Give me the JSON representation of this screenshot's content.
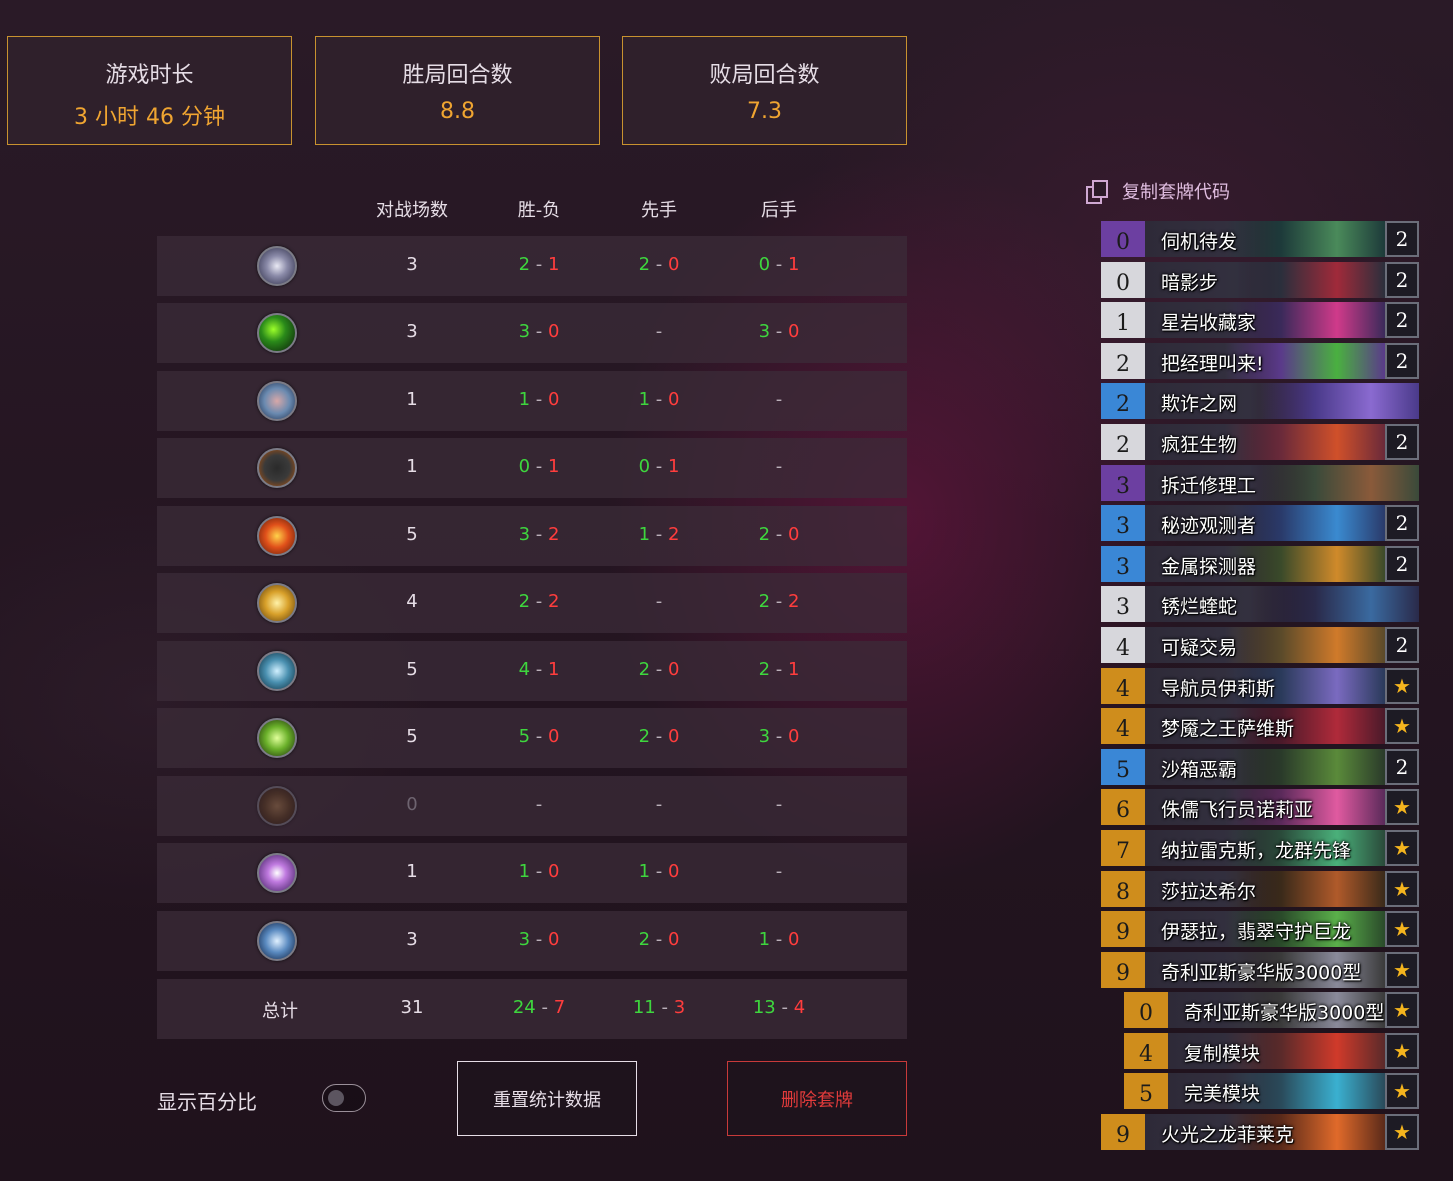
{
  "summary": [
    {
      "label": "游戏时长",
      "value": "3 小时 46 分钟"
    },
    {
      "label": "胜局回合数",
      "value": "8.8"
    },
    {
      "label": "败局回合数",
      "value": "7.3"
    }
  ],
  "table": {
    "headers": [
      "对战场数",
      "胜-负",
      "先手",
      "后手"
    ],
    "rows": [
      {
        "icon": "priest-class-icon",
        "games": "3",
        "wl": [
          "2",
          "1"
        ],
        "first": [
          "2",
          "0"
        ],
        "second": [
          "0",
          "1"
        ]
      },
      {
        "icon": "druid-class-icon",
        "games": "3",
        "wl": [
          "3",
          "0"
        ],
        "first": null,
        "second": [
          "3",
          "0"
        ]
      },
      {
        "icon": "shaman-class-icon",
        "games": "1",
        "wl": [
          "1",
          "0"
        ],
        "first": [
          "1",
          "0"
        ],
        "second": null
      },
      {
        "icon": "hunter-class-icon",
        "games": "1",
        "wl": [
          "0",
          "1"
        ],
        "first": [
          "0",
          "1"
        ],
        "second": null
      },
      {
        "icon": "mage-class-icon",
        "games": "5",
        "wl": [
          "3",
          "2"
        ],
        "first": [
          "1",
          "2"
        ],
        "second": [
          "2",
          "0"
        ]
      },
      {
        "icon": "paladin-class-icon",
        "games": "4",
        "wl": [
          "2",
          "2"
        ],
        "first": null,
        "second": [
          "2",
          "2"
        ]
      },
      {
        "icon": "deathknight-class-icon",
        "games": "5",
        "wl": [
          "4",
          "1"
        ],
        "first": [
          "2",
          "0"
        ],
        "second": [
          "2",
          "1"
        ]
      },
      {
        "icon": "demonhunter-class-icon",
        "games": "5",
        "wl": [
          "5",
          "0"
        ],
        "first": [
          "2",
          "0"
        ],
        "second": [
          "3",
          "0"
        ]
      },
      {
        "icon": "warrior-class-icon",
        "games": "0",
        "wl": null,
        "first": null,
        "second": null,
        "dim": true
      },
      {
        "icon": "warlock-class-icon",
        "games": "1",
        "wl": [
          "1",
          "0"
        ],
        "first": [
          "1",
          "0"
        ],
        "second": null
      },
      {
        "icon": "rogue-class-icon",
        "games": "3",
        "wl": [
          "3",
          "0"
        ],
        "first": [
          "2",
          "0"
        ],
        "second": [
          "1",
          "0"
        ]
      }
    ],
    "total": {
      "label": "总计",
      "games": "31",
      "wl": [
        "24",
        "7"
      ],
      "first": [
        "11",
        "3"
      ],
      "second": [
        "13",
        "4"
      ]
    },
    "dash": "-"
  },
  "controls": {
    "show_percent_label": "显示百分比",
    "show_percent_on": false,
    "reset_label": "重置统计数据",
    "delete_label": "删除套牌"
  },
  "deck": {
    "copy_label": "复制套牌代码",
    "cards": [
      {
        "cost": "0",
        "name": "伺机待发",
        "count": "2",
        "rarity": "purple",
        "art": [
          "#1d3a3a",
          "#4a8a5a"
        ]
      },
      {
        "cost": "0",
        "name": "暗影步",
        "count": "2",
        "rarity": "white",
        "art": [
          "#2b2f3c",
          "#a02a3a"
        ]
      },
      {
        "cost": "1",
        "name": "星岩收藏家",
        "count": "2",
        "rarity": "white",
        "art": [
          "#3a2a5a",
          "#d03a8a"
        ]
      },
      {
        "cost": "2",
        "name": "把经理叫来!",
        "count": "2",
        "rarity": "white",
        "art": [
          "#5a3a8a",
          "#4ab040"
        ]
      },
      {
        "cost": "2",
        "name": "欺诈之网",
        "count": "",
        "rarity": "blue",
        "art": [
          "#4a3a8a",
          "#8a6ad0"
        ]
      },
      {
        "cost": "2",
        "name": "疯狂生物",
        "count": "2",
        "rarity": "white",
        "art": [
          "#6a2a3a",
          "#d0502a"
        ]
      },
      {
        "cost": "3",
        "name": "拆迁修理工",
        "count": "",
        "rarity": "purple",
        "art": [
          "#3a4a3a",
          "#8a5a3a"
        ]
      },
      {
        "cost": "3",
        "name": "秘迹观测者",
        "count": "2",
        "rarity": "blue",
        "art": [
          "#2a3a6a",
          "#3a8ad0"
        ]
      },
      {
        "cost": "3",
        "name": "金属探测器",
        "count": "2",
        "rarity": "blue",
        "art": [
          "#3a4a2a",
          "#d08a2a"
        ]
      },
      {
        "cost": "3",
        "name": "锈烂蝰蛇",
        "count": "",
        "rarity": "white",
        "art": [
          "#2a2a4a",
          "#3a6aa0"
        ]
      },
      {
        "cost": "4",
        "name": "可疑交易",
        "count": "2",
        "rarity": "white",
        "art": [
          "#5a4a2a",
          "#d07a2a"
        ]
      },
      {
        "cost": "4",
        "name": "导航员伊莉斯",
        "count": "★",
        "rarity": "orange",
        "art": [
          "#2a3a5a",
          "#7a6ac0"
        ]
      },
      {
        "cost": "4",
        "name": "梦魇之王萨维斯",
        "count": "★",
        "rarity": "orange",
        "art": [
          "#4a1a2a",
          "#b02a3a"
        ]
      },
      {
        "cost": "5",
        "name": "沙箱恶霸",
        "count": "2",
        "rarity": "blue",
        "art": [
          "#2a3a2a",
          "#5a8a3a"
        ]
      },
      {
        "cost": "6",
        "name": "侏儒飞行员诺莉亚",
        "count": "★",
        "rarity": "orange",
        "art": [
          "#5a2a5a",
          "#e05aa0"
        ]
      },
      {
        "cost": "7",
        "name": "纳拉雷克斯，龙群先锋",
        "count": "★",
        "rarity": "orange",
        "art": [
          "#2a4a3a",
          "#4ab07a"
        ]
      },
      {
        "cost": "8",
        "name": "莎拉达希尔",
        "count": "★",
        "rarity": "orange",
        "art": [
          "#3a2a1a",
          "#b05a2a"
        ]
      },
      {
        "cost": "9",
        "name": "伊瑟拉，翡翠守护巨龙",
        "count": "★",
        "rarity": "orange",
        "art": [
          "#2a4a2a",
          "#5ab04a"
        ]
      },
      {
        "cost": "9",
        "name": "奇利亚斯豪华版3000型",
        "count": "★",
        "rarity": "orange",
        "art": [
          "#3a3a3a",
          "#8a8a9a"
        ]
      },
      {
        "cost": "0",
        "name": "奇利亚斯豪华版3000型",
        "count": "★",
        "rarity": "orange",
        "sub": true,
        "art": [
          "#3a3a3a",
          "#8a8a9a"
        ]
      },
      {
        "cost": "4",
        "name": "复制模块",
        "count": "★",
        "rarity": "orange",
        "sub": true,
        "art": [
          "#5a2a2a",
          "#d03a2a"
        ]
      },
      {
        "cost": "5",
        "name": "完美模块",
        "count": "★",
        "rarity": "orange",
        "sub": true,
        "art": [
          "#2a4a5a",
          "#3ab0d0"
        ]
      },
      {
        "cost": "9",
        "name": "火光之龙菲莱克",
        "count": "★",
        "rarity": "orange",
        "art": [
          "#5a2a1a",
          "#e06a2a"
        ]
      }
    ]
  },
  "colors": {
    "accent_gold": "#f0a531",
    "win_green": "#3ed63e",
    "loss_red": "#ff3d3d",
    "delete_red": "#e23b3b"
  }
}
